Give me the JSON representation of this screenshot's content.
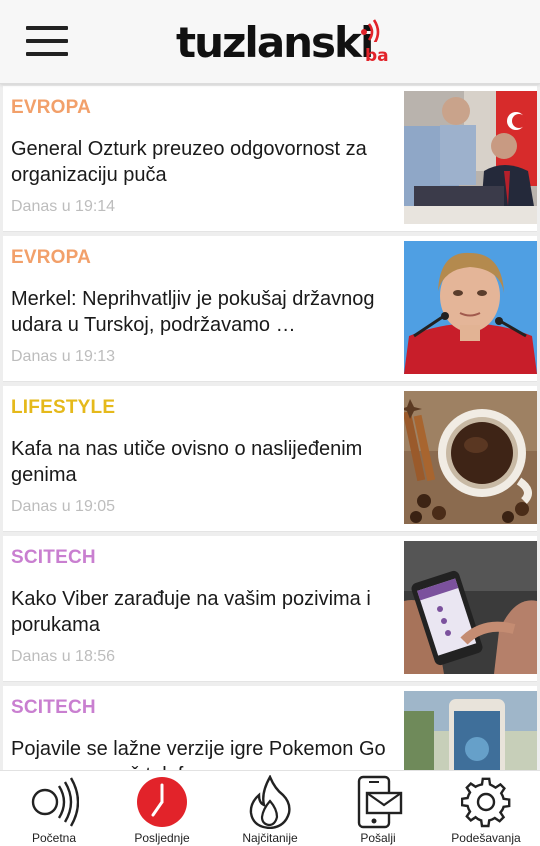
{
  "header": {
    "logo_text": "tuzlanski",
    "logo_suffix": "ba"
  },
  "articles": [
    {
      "category": "EVROPA",
      "category_color": "#f2a06a",
      "title": "General Ozturk preuzeo odgovornost za organizaciju puča",
      "time": "Danas u 19:14"
    },
    {
      "category": "EVROPA",
      "category_color": "#f2a06a",
      "title": "Merkel: Neprihvatljiv je pokušaj državnog udara u Turskoj, podržavamo …",
      "time": "Danas u 19:13"
    },
    {
      "category": "LIFESTYLE",
      "category_color": "#e5b91b",
      "title": "Kafa na nas utiče ovisno o naslijeđenim genima",
      "time": "Danas u 19:05"
    },
    {
      "category": "SCITECH",
      "category_color": "#c97fd0",
      "title": "Kako Viber zarađuje na vašim pozivima i porukama",
      "time": "Danas u 18:56"
    },
    {
      "category": "SCITECH",
      "category_color": "#c97fd0",
      "title": "Pojavile se lažne verzije igre Pokemon Go opasne za vaš telefon",
      "time": ""
    }
  ],
  "bottom_nav": [
    {
      "label": "Početna",
      "icon": "radio-waves-icon",
      "active": false
    },
    {
      "label": "Posljednje",
      "icon": "clock-icon",
      "active": true
    },
    {
      "label": "Najčitanije",
      "icon": "flame-icon",
      "active": false
    },
    {
      "label": "Pošalji",
      "icon": "phone-mail-icon",
      "active": false
    },
    {
      "label": "Podešavanja",
      "icon": "gear-icon",
      "active": false
    }
  ],
  "colors": {
    "brand_red": "#e2232a",
    "category_evropa": "#f2a06a",
    "category_lifestyle": "#e5b91b",
    "category_scitech": "#c97fd0"
  }
}
